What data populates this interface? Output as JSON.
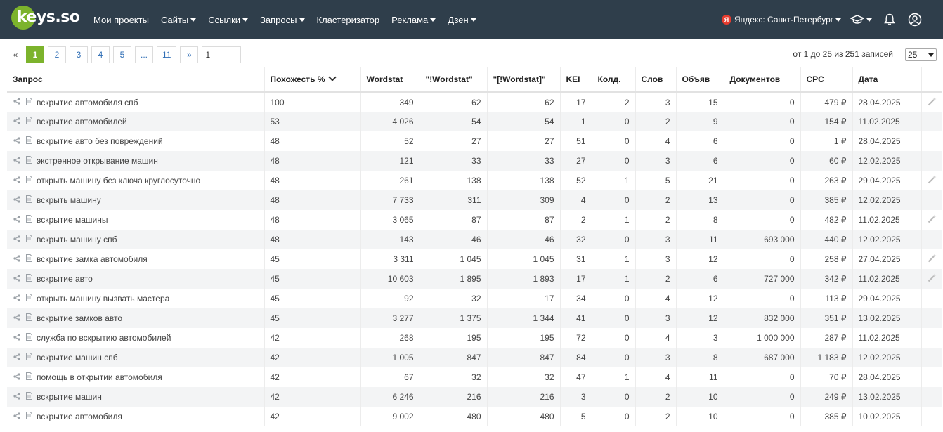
{
  "header": {
    "logo_text": "keys.so",
    "nav": [
      {
        "label": "Мои проекты",
        "caret": false
      },
      {
        "label": "Сайты",
        "caret": true
      },
      {
        "label": "Ссылки",
        "caret": true
      },
      {
        "label": "Запросы",
        "caret": true
      },
      {
        "label": "Кластеризатор",
        "caret": false
      },
      {
        "label": "Реклама",
        "caret": true
      },
      {
        "label": "Дзен",
        "caret": true
      }
    ],
    "region_badge": "Я",
    "region": "Яндекс: Санкт-Петербург",
    "icons": [
      "graduation-cap-icon",
      "bell-icon",
      "user-icon"
    ]
  },
  "pagination": {
    "prev": "«",
    "pages": [
      "1",
      "2",
      "3",
      "4",
      "5",
      "...",
      "11"
    ],
    "active": "1",
    "next": "»",
    "goto_value": "1"
  },
  "records_text": "от 1 до 25 из 251 записей",
  "per_page": "25",
  "table": {
    "columns": [
      "Запрос",
      "Похожесть %",
      "Wordstat",
      "\"!Wordstat\"",
      "\"[!Wordstat]\"",
      "KEI",
      "Колд.",
      "Слов",
      "Объяв",
      "Документов",
      "CPC",
      "Дата"
    ],
    "rows": [
      {
        "q": "вскрытие автомобиля спб",
        "sim": "100",
        "ws": "349",
        "ws2": "62",
        "ws3": "62",
        "kei": "17",
        "kold": "2",
        "slov": "3",
        "obyav": "15",
        "docs": "0",
        "cpc": "479 ₽",
        "date": "28.04.2025",
        "wand": true
      },
      {
        "q": "вскрытие автомобилей",
        "sim": "53",
        "ws": "4 026",
        "ws2": "54",
        "ws3": "54",
        "kei": "1",
        "kold": "0",
        "slov": "2",
        "obyav": "9",
        "docs": "0",
        "cpc": "154 ₽",
        "date": "11.02.2025",
        "wand": false
      },
      {
        "q": "вскрытие авто без повреждений",
        "sim": "48",
        "ws": "52",
        "ws2": "27",
        "ws3": "27",
        "kei": "51",
        "kold": "0",
        "slov": "4",
        "obyav": "6",
        "docs": "0",
        "cpc": "1 ₽",
        "date": "28.04.2025",
        "wand": false
      },
      {
        "q": "экстренное открывание машин",
        "sim": "48",
        "ws": "121",
        "ws2": "33",
        "ws3": "33",
        "kei": "27",
        "kold": "0",
        "slov": "3",
        "obyav": "6",
        "docs": "0",
        "cpc": "60 ₽",
        "date": "12.02.2025",
        "wand": false
      },
      {
        "q": "открыть машину без ключа круглосуточно",
        "sim": "48",
        "ws": "261",
        "ws2": "138",
        "ws3": "138",
        "kei": "52",
        "kold": "1",
        "slov": "5",
        "obyav": "21",
        "docs": "0",
        "cpc": "263 ₽",
        "date": "29.04.2025",
        "wand": true
      },
      {
        "q": "вскрыть машину",
        "sim": "48",
        "ws": "7 733",
        "ws2": "311",
        "ws3": "309",
        "kei": "4",
        "kold": "0",
        "slov": "2",
        "obyav": "13",
        "docs": "0",
        "cpc": "385 ₽",
        "date": "12.02.2025",
        "wand": false
      },
      {
        "q": "вскрытие машины",
        "sim": "48",
        "ws": "3 065",
        "ws2": "87",
        "ws3": "87",
        "kei": "2",
        "kold": "1",
        "slov": "2",
        "obyav": "8",
        "docs": "0",
        "cpc": "482 ₽",
        "date": "11.02.2025",
        "wand": true
      },
      {
        "q": "вскрыть машину спб",
        "sim": "48",
        "ws": "143",
        "ws2": "46",
        "ws3": "46",
        "kei": "32",
        "kold": "0",
        "slov": "3",
        "obyav": "11",
        "docs": "693 000",
        "cpc": "440 ₽",
        "date": "12.02.2025",
        "wand": false
      },
      {
        "q": "вскрытие замка автомобиля",
        "sim": "45",
        "ws": "3 311",
        "ws2": "1 045",
        "ws3": "1 045",
        "kei": "31",
        "kold": "1",
        "slov": "3",
        "obyav": "12",
        "docs": "0",
        "cpc": "258 ₽",
        "date": "27.04.2025",
        "wand": true
      },
      {
        "q": "вскрытие авто",
        "sim": "45",
        "ws": "10 603",
        "ws2": "1 895",
        "ws3": "1 893",
        "kei": "17",
        "kold": "1",
        "slov": "2",
        "obyav": "6",
        "docs": "727 000",
        "cpc": "342 ₽",
        "date": "11.02.2025",
        "wand": true
      },
      {
        "q": "открыть машину вызвать мастера",
        "sim": "45",
        "ws": "92",
        "ws2": "32",
        "ws3": "17",
        "kei": "34",
        "kold": "0",
        "slov": "4",
        "obyav": "12",
        "docs": "0",
        "cpc": "113 ₽",
        "date": "29.04.2025",
        "wand": false
      },
      {
        "q": "вскрытие замков авто",
        "sim": "45",
        "ws": "3 277",
        "ws2": "1 375",
        "ws3": "1 344",
        "kei": "41",
        "kold": "0",
        "slov": "3",
        "obyav": "12",
        "docs": "832 000",
        "cpc": "351 ₽",
        "date": "13.02.2025",
        "wand": false
      },
      {
        "q": "служба по вскрытию автомобилей",
        "sim": "42",
        "ws": "268",
        "ws2": "195",
        "ws3": "195",
        "kei": "72",
        "kold": "0",
        "slov": "4",
        "obyav": "3",
        "docs": "1 000 000",
        "cpc": "287 ₽",
        "date": "11.02.2025",
        "wand": false
      },
      {
        "q": "вскрытие машин спб",
        "sim": "42",
        "ws": "1 005",
        "ws2": "847",
        "ws3": "847",
        "kei": "84",
        "kold": "0",
        "slov": "3",
        "obyav": "8",
        "docs": "687 000",
        "cpc": "1 183 ₽",
        "date": "12.02.2025",
        "wand": false
      },
      {
        "q": "помощь в открытии автомобиля",
        "sim": "42",
        "ws": "67",
        "ws2": "32",
        "ws3": "32",
        "kei": "47",
        "kold": "1",
        "slov": "4",
        "obyav": "11",
        "docs": "0",
        "cpc": "70 ₽",
        "date": "28.04.2025",
        "wand": false
      },
      {
        "q": "вскрытие машин",
        "sim": "42",
        "ws": "6 246",
        "ws2": "216",
        "ws3": "216",
        "kei": "3",
        "kold": "0",
        "slov": "2",
        "obyav": "10",
        "docs": "0",
        "cpc": "249 ₽",
        "date": "13.02.2025",
        "wand": false
      },
      {
        "q": "вскрытие автомобиля",
        "sim": "42",
        "ws": "9 002",
        "ws2": "480",
        "ws3": "480",
        "kei": "5",
        "kold": "0",
        "slov": "2",
        "obyav": "10",
        "docs": "0",
        "cpc": "385 ₽",
        "date": "10.02.2025",
        "wand": false
      }
    ]
  }
}
